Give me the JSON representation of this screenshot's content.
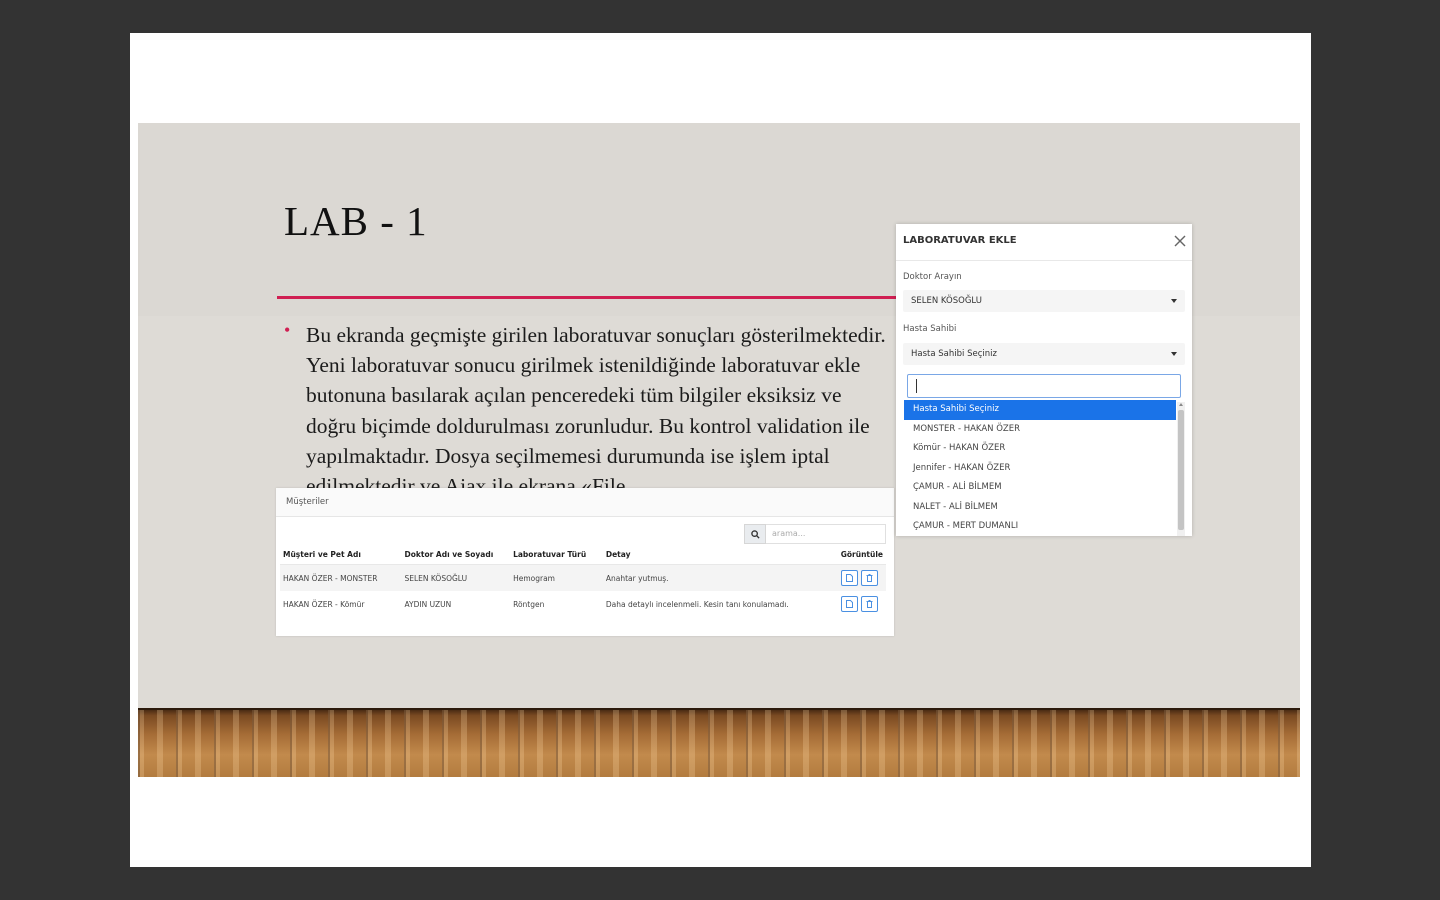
{
  "slide": {
    "title": "LAB - 1",
    "bullet": "Bu ekranda geçmişte girilen laboratuvar sonuçları gösterilmektedir.  Yeni laboratuvar sonucu girilmek istenildiğinde laboratuvar ekle butonuna basılarak açılan penceredeki tüm bilgiler eksiksiz ve doğru biçimde doldurulması zorunludur. Bu kontrol validation ile yapılmaktadır. Dosya seçilmemesi durumunda ise işlem iptal edilmektedir ve Ajax ile ekrana «File",
    "accent_color": "#d01f52"
  },
  "customers": {
    "header": "Müşteriler",
    "search_placeholder": "arama...",
    "columns": [
      "Müşteri ve Pet Adı",
      "Doktor Adı ve Soyadı",
      "Laboratuvar Türü",
      "Detay",
      "Görüntüle"
    ],
    "rows": [
      {
        "customer": "HAKAN ÖZER - MONSTER",
        "doctor": "SELEN KÖSOĞLU",
        "type": "Hemogram",
        "detail": "Anahtar yutmuş."
      },
      {
        "customer": "HAKAN ÖZER - Kömür",
        "doctor": "AYDIN UZUN",
        "type": "Röntgen",
        "detail": "Daha detaylı incelenmeli. Kesin tanı konulamadı."
      }
    ]
  },
  "modal": {
    "title": "LABORATUVAR EKLE",
    "doctor_label": "Doktor Arayın",
    "doctor_value": "SELEN KÖSOĞLU",
    "owner_label": "Hasta Sahibi",
    "owner_value": "Hasta Sahibi Seçiniz",
    "options": [
      "Hasta Sahibi Seçiniz",
      "MONSTER - HAKAN ÖZER",
      "Kömür - HAKAN ÖZER",
      "Jennifer - HAKAN ÖZER",
      "ÇAMUR - ALİ BİLMEM",
      "NALET - ALİ BİLMEM",
      "ÇAMUR - MERT DUMANLI"
    ],
    "selected_color": "#1a73e8"
  }
}
